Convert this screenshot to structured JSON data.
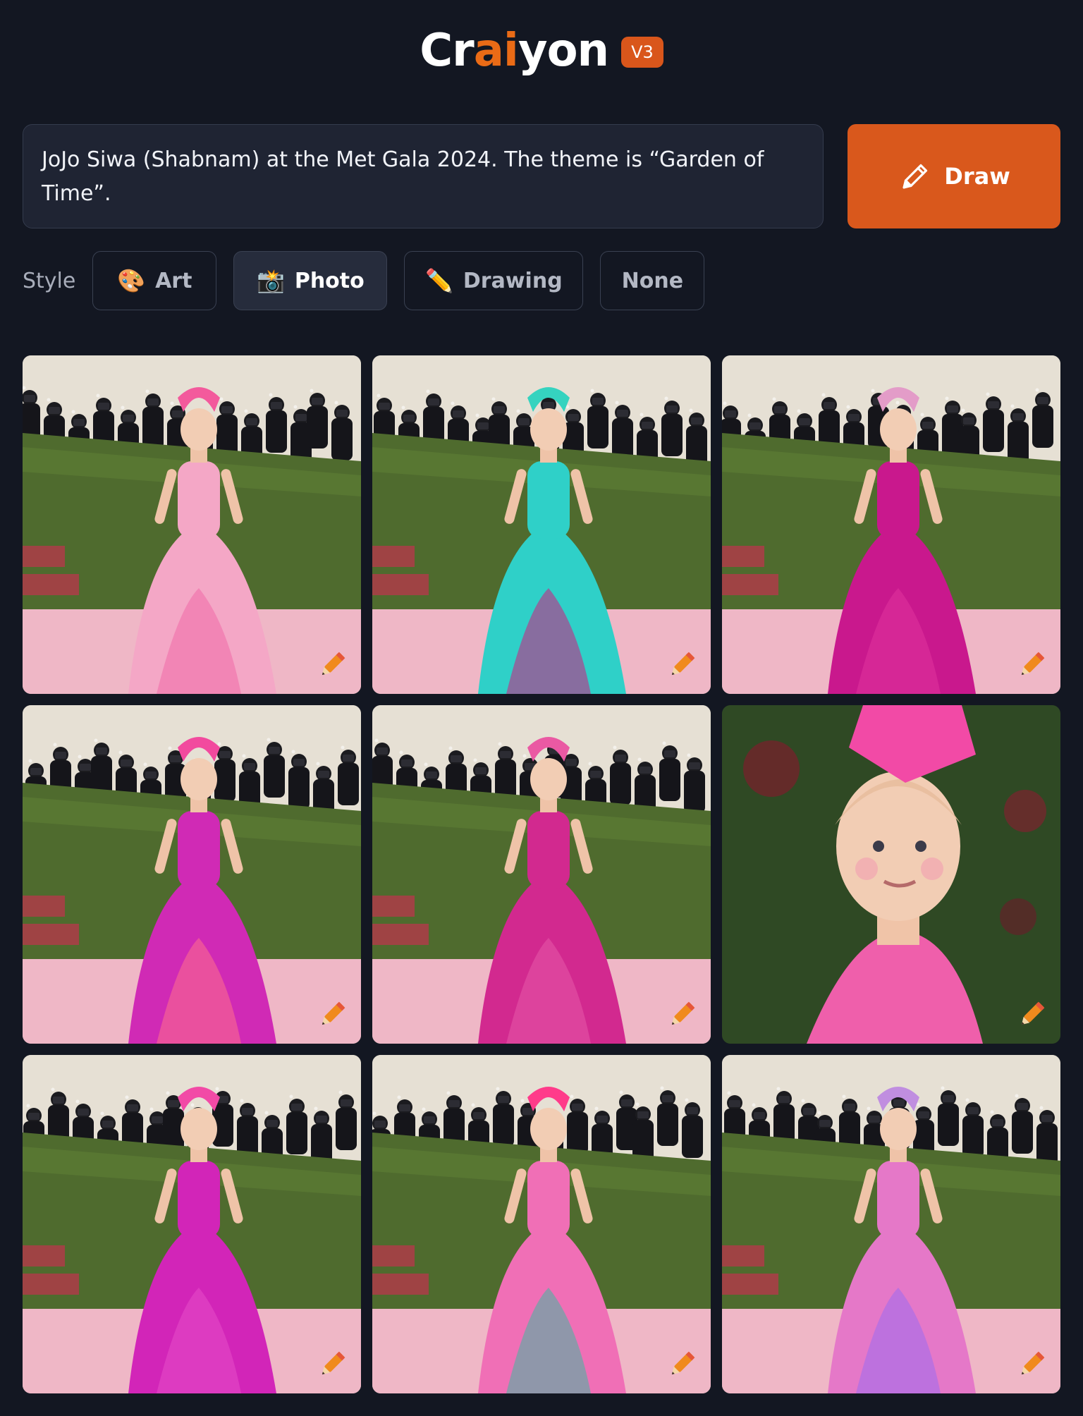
{
  "logo": {
    "text_before": "Cr",
    "text_accent": "ai",
    "text_after": "yon",
    "version": "V3"
  },
  "prompt": {
    "value": "JoJo Siwa (Shabnam) at the Met Gala 2024. The theme is “Garden of Time”."
  },
  "draw_button": {
    "label": "Draw",
    "icon": "pencil-icon"
  },
  "style": {
    "label": "Style",
    "options": [
      {
        "label": "Art",
        "icon": "🎨",
        "icon_name": "palette-icon",
        "active": false
      },
      {
        "label": "Photo",
        "icon": "📸",
        "icon_name": "camera-flash-icon",
        "active": true
      },
      {
        "label": "Drawing",
        "icon": "✏️",
        "icon_name": "pencil-icon",
        "active": false
      },
      {
        "label": "None",
        "icon": "",
        "icon_name": "",
        "active": false
      }
    ]
  },
  "images": [
    {
      "kind": "light-pink-ballgown",
      "dress": "#f4a7c6",
      "accent": "#f06aa8",
      "hair": "#f35a9c"
    },
    {
      "kind": "teal-crop-top-pink-cape",
      "dress": "#2fd0c8",
      "accent": "#d21b7d",
      "hair": "#35d3bf"
    },
    {
      "kind": "magenta-gown-pose",
      "dress": "#c9188d",
      "accent": "#e0359f",
      "hair": "#e39cc8"
    },
    {
      "kind": "multicolor-ruffled-gown",
      "dress": "#d02ab5",
      "accent": "#ff6f8a",
      "hair": "#f24a9e"
    },
    {
      "kind": "magenta-train-gown",
      "dress": "#d2298f",
      "accent": "#e659a9",
      "hair": "#ea59a3"
    },
    {
      "kind": "closeup-pink-bow",
      "dress": "#ef5fab",
      "accent": "#f24aa6",
      "hair": "#f0a8c8"
    },
    {
      "kind": "tiered-magenta-gown",
      "dress": "#d225b8",
      "accent": "#e64ec8",
      "hair": "#f24aa6"
    },
    {
      "kind": "embellished-pink-gown",
      "dress": "#f06fb6",
      "accent": "#3fb8a0",
      "hair": "#ff3b8a"
    },
    {
      "kind": "lavender-jeweled-gown",
      "dress": "#e578c8",
      "accent": "#9c6cf0",
      "hair": "#c08ee0"
    }
  ],
  "colors": {
    "background": "#131722",
    "accent": "#d9581c",
    "prompt_bg": "#1f2433"
  }
}
